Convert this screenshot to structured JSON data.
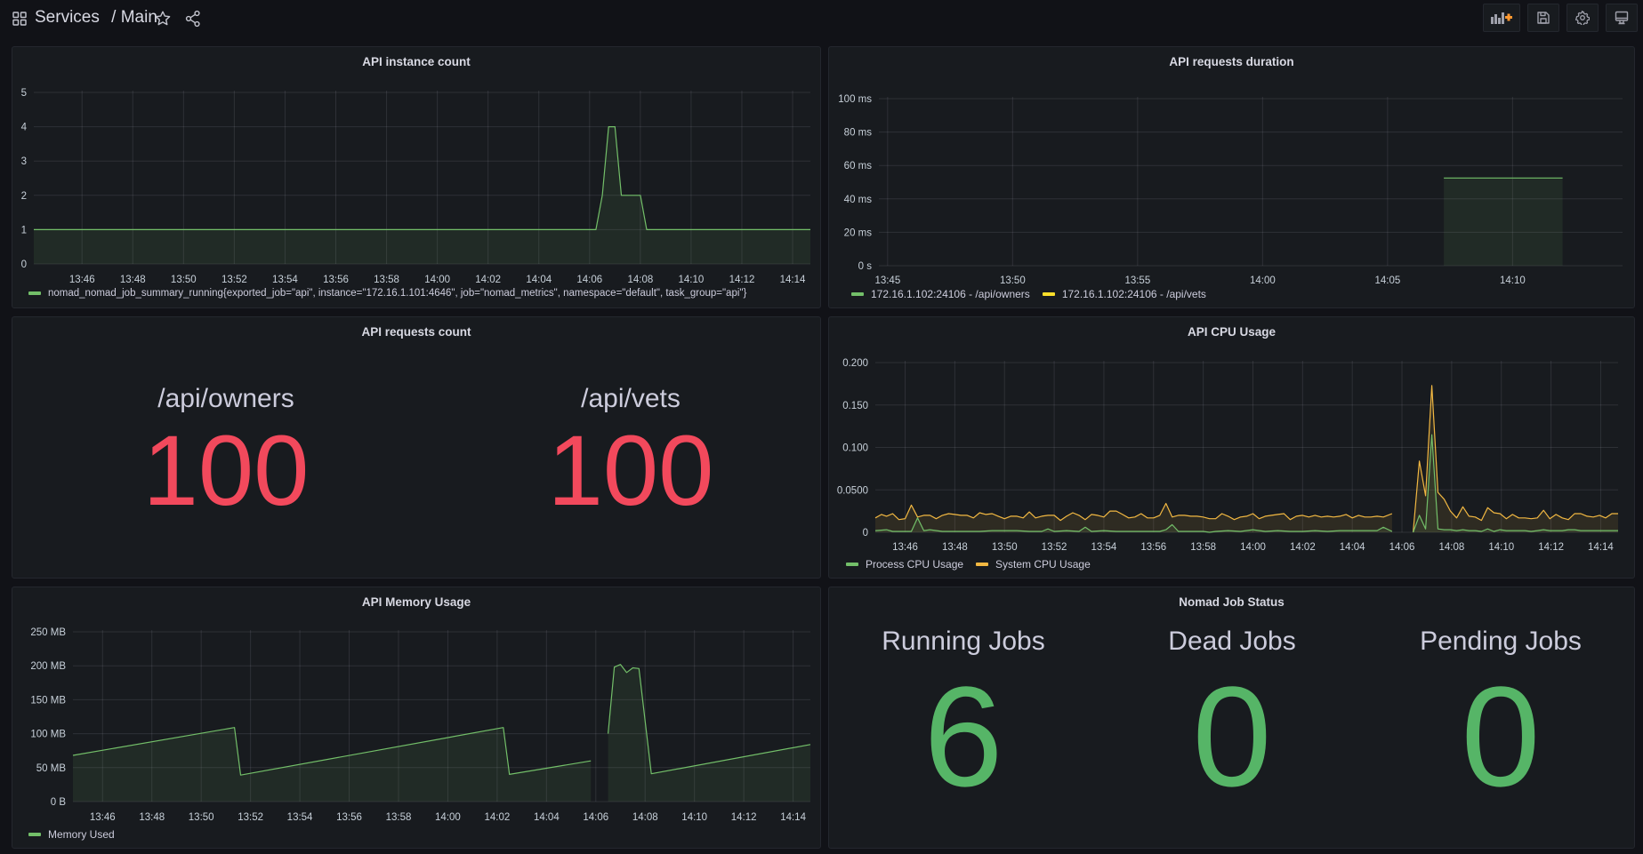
{
  "header": {
    "breadcrumb_folder": "Services",
    "breadcrumb_separator": "/",
    "dashboard_title": "Main",
    "icons": {
      "apps": "apps-grid-icon",
      "star": "star-icon",
      "share": "share-icon",
      "add_panel": "add-panel-icon",
      "save": "save-icon",
      "settings": "gear-icon",
      "view_mode": "monitor-icon"
    }
  },
  "colors": {
    "green": "#73bf69",
    "yellow": "#f2c94c",
    "orange_system": "#f2b842",
    "red_stat": "#f2495c",
    "green_stat": "#56b567",
    "add_panel_accent": "#ff9830"
  },
  "panels": {
    "instance_count": {
      "title": "API instance count",
      "legend": [
        {
          "label": "nomad_nomad_job_summary_running{exported_job=\"api\", instance=\"172.16.1.101:4646\", job=\"nomad_metrics\", namespace=\"default\", task_group=\"api\"}",
          "color": "#73bf69"
        }
      ]
    },
    "requests_duration": {
      "title": "API requests duration",
      "legend": [
        {
          "label": "172.16.1.102:24106 - /api/owners",
          "color": "#73bf69"
        },
        {
          "label": "172.16.1.102:24106 - /api/vets",
          "color": "#fade2a"
        }
      ]
    },
    "requests_count": {
      "title": "API requests count",
      "stats": [
        {
          "label": "/api/owners",
          "value": "100"
        },
        {
          "label": "/api/vets",
          "value": "100"
        }
      ]
    },
    "cpu_usage": {
      "title": "API CPU Usage",
      "legend": [
        {
          "label": "Process CPU Usage",
          "color": "#73bf69"
        },
        {
          "label": "System CPU Usage",
          "color": "#f2b842"
        }
      ]
    },
    "memory_usage": {
      "title": "API Memory Usage",
      "legend": [
        {
          "label": "Memory Used",
          "color": "#73bf69"
        }
      ]
    },
    "job_status": {
      "title": "Nomad Job Status",
      "stats": [
        {
          "label": "Running Jobs",
          "value": "6"
        },
        {
          "label": "Dead Jobs",
          "value": "0"
        },
        {
          "label": "Pending Jobs",
          "value": "0"
        }
      ]
    }
  },
  "chart_data": [
    {
      "id": "instance_count",
      "type": "area",
      "title": "API instance count",
      "xlabel": "",
      "ylabel": "",
      "x_range": [
        "13:44.9",
        "14:14.7"
      ],
      "xlim_min": [
        -0.9,
        29.7
      ],
      "x_ticks": [
        "13:46",
        "13:48",
        "13:50",
        "13:52",
        "13:54",
        "13:56",
        "13:58",
        "14:00",
        "14:02",
        "14:04",
        "14:06",
        "14:08",
        "14:10",
        "14:12",
        "14:14"
      ],
      "x_tick_min": [
        1,
        3,
        5,
        7,
        9,
        11,
        13,
        15,
        17,
        19,
        21,
        23,
        25,
        27,
        29
      ],
      "y_ticks": [
        "0",
        "1",
        "2",
        "3",
        "4",
        "5"
      ],
      "ylim": [
        0,
        5
      ],
      "grid": true,
      "legend_position": "bottom-left",
      "series": [
        {
          "name": "nomad_nomad_job_summary_running",
          "color": "#73bf69",
          "x": [
            -0.9,
            21.25,
            21.5,
            21.75,
            22.0,
            22.25,
            22.4,
            23.0,
            23.25,
            29.7
          ],
          "y": [
            1,
            1,
            2,
            4,
            4,
            2,
            2,
            2,
            1,
            1
          ]
        }
      ]
    },
    {
      "id": "requests_duration",
      "type": "area",
      "title": "API requests duration",
      "x_ticks": [
        "13:45",
        "13:50",
        "13:55",
        "14:00",
        "14:05",
        "14:10"
      ],
      "x_tick_min": [
        0,
        5,
        10,
        15,
        20,
        25
      ],
      "xlim_min": [
        -0.35,
        29.4
      ],
      "y_ticks": [
        "0 s",
        "20 ms",
        "40 ms",
        "60 ms",
        "80 ms",
        "100 ms"
      ],
      "ylim": [
        0,
        100
      ],
      "grid": true,
      "legend_position": "bottom-left",
      "series": [
        {
          "name": "172.16.1.102:24106 - /api/owners",
          "color": "#73bf69",
          "x": [
            22.25,
            27.0
          ],
          "y": [
            52.5,
            52.5
          ]
        },
        {
          "name": "172.16.1.102:24106 - /api/vets",
          "color": "#fade2a",
          "x": [],
          "y": []
        }
      ]
    },
    {
      "id": "cpu_usage",
      "type": "area",
      "title": "API CPU Usage",
      "x_ticks": [
        "13:46",
        "13:48",
        "13:50",
        "13:52",
        "13:54",
        "13:56",
        "13:58",
        "14:00",
        "14:02",
        "14:04",
        "14:06",
        "14:08",
        "14:10",
        "14:12",
        "14:14"
      ],
      "x_tick_min": [
        1,
        3,
        5,
        7,
        9,
        11,
        13,
        15,
        17,
        19,
        21,
        23,
        25,
        27,
        29
      ],
      "xlim_min": [
        -0.2,
        29.7
      ],
      "y_ticks": [
        "0",
        "0.0500",
        "0.100",
        "0.150",
        "0.200"
      ],
      "ylim": [
        0,
        0.2
      ],
      "grid": true,
      "legend_position": "bottom-left",
      "series": [
        {
          "name": "System CPU Usage",
          "color": "#f2b842",
          "segments": [
            {
              "x": [
                -0.2,
                0.05,
                0.25,
                0.5,
                0.75,
                1.0,
                1.25,
                1.5,
                1.75,
                2.0,
                2.25,
                2.5,
                2.75,
                3.0,
                3.25,
                3.5,
                3.75,
                4.0,
                4.25,
                4.5,
                4.75,
                5.0,
                5.25,
                5.5,
                5.75,
                6.0,
                6.25,
                6.5,
                6.75,
                7.0,
                7.25,
                7.5,
                7.75,
                8.0,
                8.25,
                8.5,
                8.75,
                9.0,
                9.25,
                9.5,
                9.75,
                10.0,
                10.25,
                10.5,
                10.75,
                11.0,
                11.25,
                11.5,
                11.75,
                12.0,
                12.25,
                12.5,
                12.75,
                13.0,
                13.25,
                13.5,
                13.75,
                14.0,
                14.25,
                14.5,
                14.75,
                15.0,
                15.25,
                15.5,
                15.75,
                16.0,
                16.25,
                16.5,
                16.75,
                17.0,
                17.25,
                17.5,
                17.75,
                18.0,
                18.25,
                18.5,
                18.75,
                19.0,
                19.25,
                19.5,
                19.75,
                20.0,
                20.25,
                20.6
              ],
              "y": [
                0.017,
                0.021,
                0.019,
                0.022,
                0.015,
                0.016,
                0.032,
                0.018,
                0.02,
                0.02,
                0.016,
                0.02,
                0.022,
                0.021,
                0.02,
                0.02,
                0.017,
                0.023,
                0.021,
                0.022,
                0.019,
                0.016,
                0.019,
                0.019,
                0.017,
                0.024,
                0.017,
                0.019,
                0.02,
                0.02,
                0.014,
                0.019,
                0.023,
                0.02,
                0.015,
                0.021,
                0.02,
                0.018,
                0.025,
                0.025,
                0.021,
                0.017,
                0.018,
                0.022,
                0.017,
                0.017,
                0.02,
                0.034,
                0.018,
                0.02,
                0.02,
                0.019,
                0.019,
                0.018,
                0.016,
                0.016,
                0.022,
                0.019,
                0.015,
                0.018,
                0.019,
                0.022,
                0.016,
                0.019,
                0.02,
                0.021,
                0.022,
                0.015,
                0.019,
                0.02,
                0.018,
                0.02,
                0.018,
                0.019,
                0.018,
                0.019,
                0.021,
                0.017,
                0.02,
                0.018,
                0.018,
                0.019,
                0.018,
                0.022
              ]
            },
            {
              "x": [
                21.45,
                21.7,
                21.95,
                22.2,
                22.45,
                22.7,
                22.95,
                23.2,
                23.45,
                23.7,
                23.95,
                24.2,
                24.45,
                24.7,
                24.95,
                25.2,
                25.45,
                25.7,
                25.95,
                26.2,
                26.45,
                26.7,
                26.95,
                27.2,
                27.45,
                27.7,
                27.95,
                28.2,
                28.45,
                28.7,
                28.95,
                29.2,
                29.45,
                29.7
              ],
              "y": [
                0,
                0.084,
                0.043,
                0.173,
                0.047,
                0.039,
                0.025,
                0.017,
                0.03,
                0.019,
                0.018,
                0.014,
                0.029,
                0.023,
                0.022,
                0.016,
                0.021,
                0.017,
                0.017,
                0.016,
                0.017,
                0.026,
                0.016,
                0.021,
                0.017,
                0.015,
                0.022,
                0.022,
                0.019,
                0.018,
                0.02,
                0.017,
                0.022,
                0.022
              ]
            }
          ]
        },
        {
          "name": "Process CPU Usage",
          "color": "#73bf69",
          "segments": [
            {
              "x": [
                -0.2,
                0.25,
                0.5,
                1.0,
                1.25,
                1.5,
                1.75,
                2.0,
                2.5,
                3.0,
                3.5,
                4.0,
                4.5,
                5.0,
                5.5,
                6.0,
                6.5,
                6.75,
                7.0,
                7.5,
                8.0,
                8.25,
                8.5,
                9.0,
                9.5,
                10.0,
                10.5,
                11.0,
                11.25,
                11.5,
                11.75,
                12.0,
                12.5,
                13.0,
                13.25,
                13.5,
                14.0,
                14.5,
                15.0,
                15.5,
                16.0,
                16.5,
                17.0,
                17.5,
                18.0,
                18.5,
                19.0,
                19.5,
                20.0,
                20.25,
                20.6
              ],
              "y": [
                0.002,
                0.003,
                0.001,
                0.001,
                0.001,
                0.017,
                0.002,
                0.003,
                0.001,
                0.001,
                0.001,
                0.001,
                0.002,
                0.002,
                0.002,
                0.001,
                0.001,
                0.004,
                0.001,
                0.002,
                0.001,
                0.006,
                0.001,
                0.002,
                0.001,
                0.001,
                0.001,
                0.001,
                0.001,
                0.003,
                0.009,
                0.001,
                0.001,
                0.001,
                0.0,
                0.001,
                0.002,
                0.001,
                0.003,
                0.001,
                0.002,
                0.001,
                0.001,
                0.002,
                0.001,
                0.002,
                0.002,
                0.002,
                0.002,
                0.006,
                0.001
              ]
            },
            {
              "x": [
                21.45,
                21.7,
                21.95,
                22.2,
                22.45,
                22.7,
                22.95,
                23.2,
                23.45,
                23.7,
                23.95,
                24.2,
                24.45,
                24.7,
                24.95,
                25.2,
                25.45,
                25.7,
                25.95,
                26.2,
                26.45,
                26.7,
                26.95,
                27.2,
                27.45,
                27.7,
                27.95,
                28.2,
                28.45,
                28.7,
                28.95,
                29.2,
                29.45,
                29.7
              ],
              "y": [
                0,
                0.02,
                0.004,
                0.115,
                0.004,
                0.003,
                0.003,
                0.002,
                0.003,
                0.002,
                0.002,
                0.001,
                0.004,
                0.001,
                0.003,
                0.002,
                0.002,
                0.002,
                0.002,
                0.001,
                0.002,
                0.003,
                0.002,
                0.002,
                0.002,
                0.003,
                0.003,
                0.002,
                0.002,
                0.002,
                0.002,
                0.002,
                0.002,
                0.002
              ]
            }
          ]
        }
      ]
    },
    {
      "id": "memory_usage",
      "type": "area",
      "title": "API Memory Usage",
      "x_ticks": [
        "13:46",
        "13:48",
        "13:50",
        "13:52",
        "13:54",
        "13:56",
        "13:58",
        "14:00",
        "14:02",
        "14:04",
        "14:06",
        "14:08",
        "14:10",
        "14:12",
        "14:14"
      ],
      "x_tick_min": [
        1,
        3,
        5,
        7,
        9,
        11,
        13,
        15,
        17,
        19,
        21,
        23,
        25,
        27,
        29
      ],
      "xlim_min": [
        -0.2,
        29.7
      ],
      "y_ticks": [
        "0 B",
        "50 MB",
        "100 MB",
        "150 MB",
        "200 MB",
        "250 MB"
      ],
      "ylim": [
        0,
        250
      ],
      "grid": true,
      "legend_position": "bottom-left",
      "series": [
        {
          "name": "Memory Used",
          "color": "#73bf69",
          "segments": [
            {
              "x": [
                -0.2,
                6.35,
                6.6,
                17.25,
                17.5,
                20.8
              ],
              "y": [
                68,
                109,
                39,
                109,
                40,
                60
              ]
            },
            {
              "x": [
                21.5,
                21.75,
                22.0,
                22.25,
                22.5,
                22.75,
                23.25,
                29.7
              ],
              "y": [
                100,
                198,
                202,
                190,
                197,
                196,
                41,
                84
              ]
            }
          ]
        }
      ]
    }
  ]
}
